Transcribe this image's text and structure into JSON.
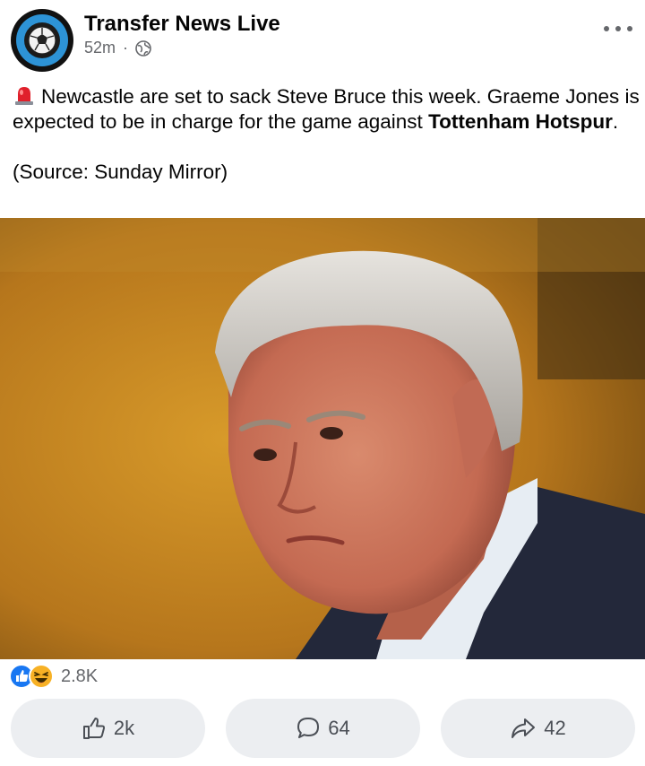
{
  "post": {
    "page_name": "Transfer News Live",
    "time": "52m",
    "separator": "·",
    "text_part1": "Newcastle are set to sack Steve Bruce this week. Graeme Jones is expected to be in charge for the game against ",
    "text_bold": "Tottenham Hotspur",
    "text_part2": ".",
    "source": "(Source: Sunday Mirror)"
  },
  "reactions": {
    "count": "2.8K"
  },
  "actions": {
    "like_count": "2k",
    "comment_count": "64",
    "share_count": "42"
  },
  "colors": {
    "text": "#050505",
    "muted": "#65676b",
    "button_bg": "#eceef1",
    "like_blue": "#1877f2",
    "haha_yellow": "#f7b125",
    "avatar_blue": "#2d93d6"
  }
}
